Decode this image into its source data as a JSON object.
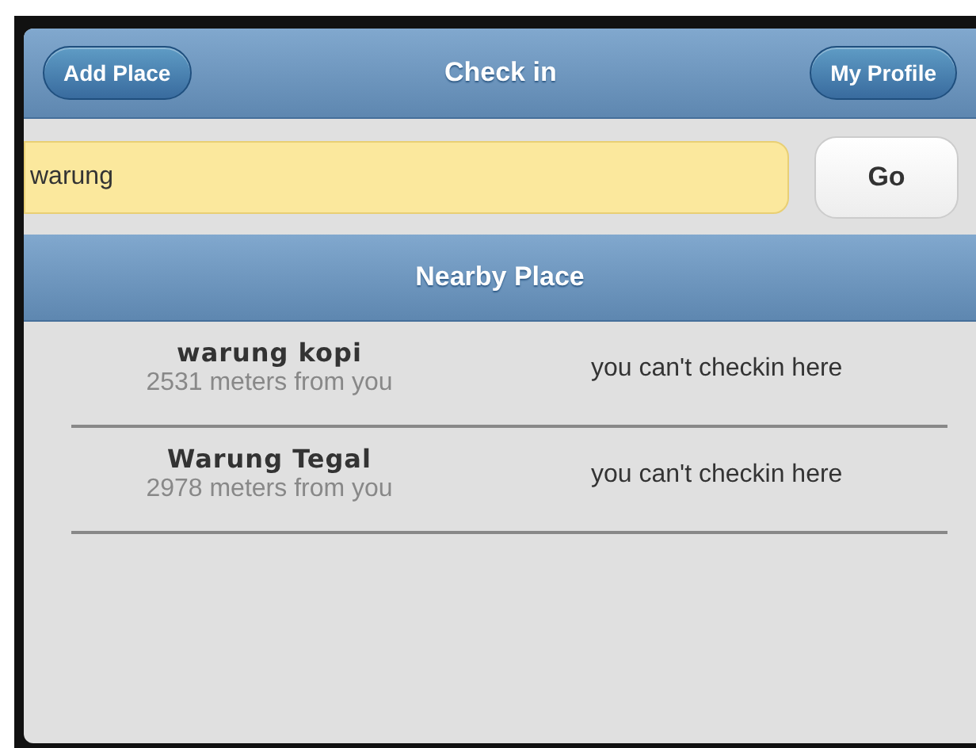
{
  "header": {
    "title": "Check in",
    "left_button": "Add Place",
    "right_button": "My Profile"
  },
  "search": {
    "value": "warung",
    "button": "Go"
  },
  "list": {
    "title": "Nearby Place",
    "items": [
      {
        "name": "warung kopi",
        "distance": "2531 meters from you",
        "status": "you can't checkin here"
      },
      {
        "name": "Warung Tegal",
        "distance": "2978 meters from you",
        "status": "you can't checkin here"
      }
    ]
  }
}
